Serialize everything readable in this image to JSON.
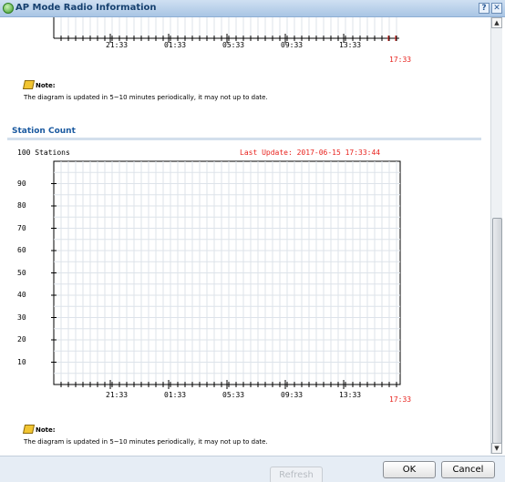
{
  "window": {
    "title": "AP Mode Radio Information",
    "help_label": "?",
    "close_label": "✕"
  },
  "top_chart": {
    "x_ticks": [
      "21:33",
      "01:33",
      "05:33",
      "09:33",
      "13:33"
    ],
    "current_time": "17:33"
  },
  "note_top": {
    "label": "Note:",
    "text": "The diagram is updated in 5~10 minutes periodically, it may not up to date."
  },
  "station_section": {
    "title": "Station Count"
  },
  "note_bottom": {
    "label": "Note:",
    "text": "The diagram is updated in 5~10 minutes periodically, it may not up to date."
  },
  "chart_data": {
    "type": "line",
    "title": "",
    "ylabel": "100 Stations",
    "last_update": "Last Update: 2017-06-15 17:33:44",
    "y_ticks": [
      "90",
      "80",
      "70",
      "60",
      "50",
      "40",
      "30",
      "20",
      "10"
    ],
    "x_ticks": [
      "21:33",
      "01:33",
      "05:33",
      "09:33",
      "13:33"
    ],
    "current_time": "17:33",
    "ylim": [
      0,
      100
    ],
    "grid": true,
    "series": []
  },
  "footer": {
    "refresh_label": "Refresh",
    "ok_label": "OK",
    "cancel_label": "Cancel"
  },
  "colors": {
    "accent": "#1b5aa0",
    "timestamp": "#e8231e",
    "grid": "#dde3ea"
  }
}
